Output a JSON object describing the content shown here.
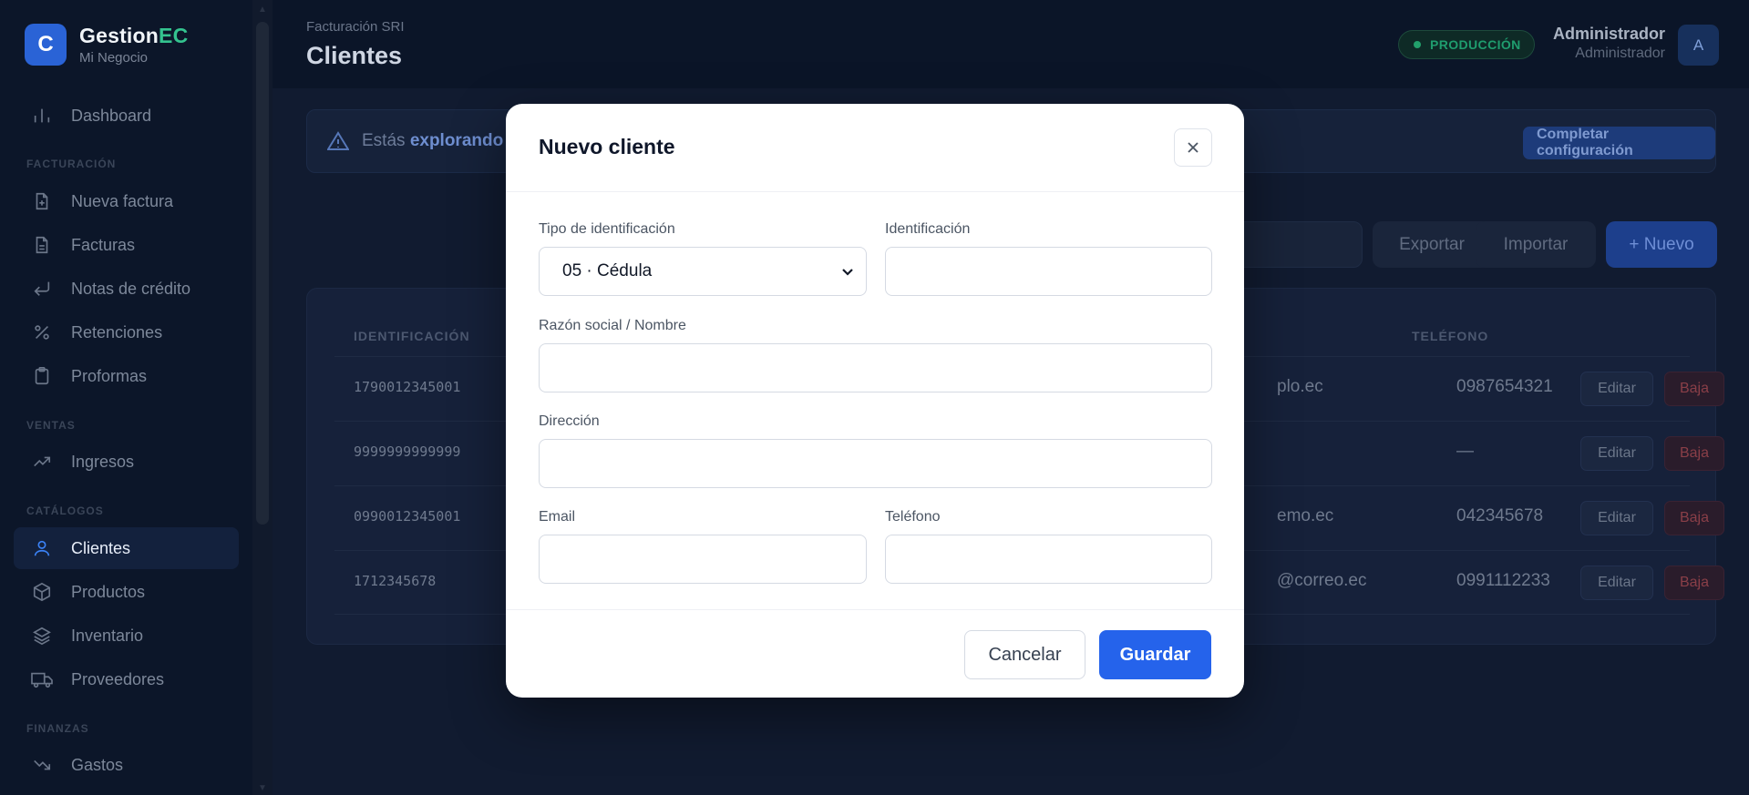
{
  "brand": {
    "logo_letter": "C",
    "name_main": "Gestion",
    "name_accent": "EC",
    "subtitle": "Mi Negocio"
  },
  "sidebar": {
    "dashboard": "Dashboard",
    "sections": {
      "facturacion": "FACTURACIÓN",
      "ventas": "VENTAS",
      "catalogos": "CATÁLOGOS",
      "finanzas": "FINANZAS"
    },
    "items": {
      "nueva_factura": "Nueva factura",
      "facturas": "Facturas",
      "notas_credito": "Notas de crédito",
      "retenciones": "Retenciones",
      "proformas": "Proformas",
      "ingresos": "Ingresos",
      "clientes": "Clientes",
      "productos": "Productos",
      "inventario": "Inventario",
      "proveedores": "Proveedores",
      "gastos": "Gastos"
    }
  },
  "header": {
    "breadcrumb": "Facturación SRI",
    "title": "Clientes",
    "env_badge": "PRODUCCIÓN",
    "user_name": "Administrador",
    "user_role": "Administrador",
    "avatar_letter": "A"
  },
  "alert": {
    "text_prefix": "Estás",
    "text_bold": "explorando",
    "action": "Completar configuración"
  },
  "toolbar": {
    "export": "Exportar",
    "import": "Importar",
    "new": "+ Nuevo"
  },
  "table": {
    "headers": {
      "identificacion": "IDENTIFICACIÓN",
      "telefono": "TELÉFONO"
    },
    "edit_label": "Editar",
    "baja_label": "Baja",
    "rows": [
      {
        "id": "1790012345001",
        "email_tail": "plo.ec",
        "phone": "0987654321"
      },
      {
        "id": "9999999999999",
        "email_tail": "",
        "phone": "—"
      },
      {
        "id": "0990012345001",
        "email_tail": "emo.ec",
        "phone": "042345678"
      },
      {
        "id": "1712345678",
        "email_tail": "@correo.ec",
        "phone": "0991112233"
      }
    ]
  },
  "modal": {
    "title": "Nuevo cliente",
    "fields": {
      "tipo_label": "Tipo de identificación",
      "tipo_value": "05 · Cédula",
      "identificacion_label": "Identificación",
      "identificacion_value": "",
      "razon_label": "Razón social / Nombre",
      "razon_value": "",
      "direccion_label": "Dirección",
      "direccion_value": "",
      "email_label": "Email",
      "email_value": "",
      "telefono_label": "Teléfono",
      "telefono_value": ""
    },
    "cancel": "Cancelar",
    "save": "Guardar"
  },
  "colors": {
    "primary": "#2563eb",
    "sidebar_bg": "#0c1629",
    "success": "#22a06b",
    "danger": "#b4232f"
  }
}
